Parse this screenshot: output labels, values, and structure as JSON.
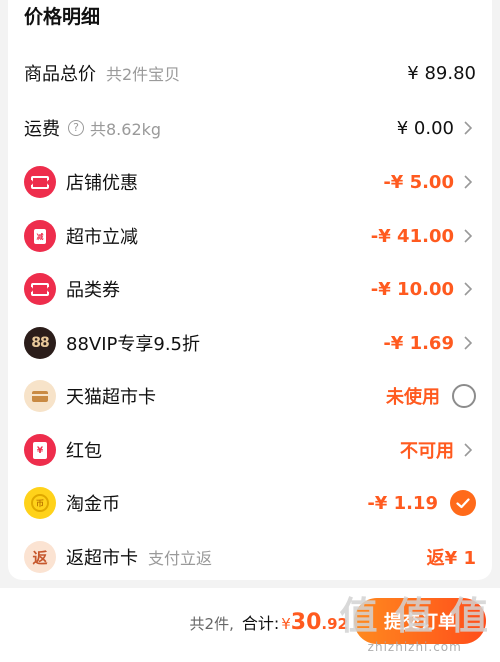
{
  "header": {
    "title": "价格明细"
  },
  "rows": [
    {
      "label": "商品总价",
      "sub": "共2件宝贝",
      "amount": "¥ 89.80"
    },
    {
      "label": "运费",
      "sub": "共8.62kg",
      "amount": "¥ 0.00"
    },
    {
      "label": "店铺优惠",
      "amount": "-¥ 5.00"
    },
    {
      "label": "超市立减",
      "amount": "-¥ 41.00"
    },
    {
      "label": "品类券",
      "amount": "-¥ 10.00"
    },
    {
      "label": "88VIP专享9.5折",
      "icon_text": "88",
      "amount": "-¥ 1.69"
    },
    {
      "label": "天猫超市卡",
      "status": "未使用"
    },
    {
      "label": "红包",
      "status": "不可用"
    },
    {
      "label": "淘金币",
      "amount": "-¥ 1.19"
    },
    {
      "label": "返超市卡",
      "sub": "支付立返",
      "icon_text": "返",
      "status": "返¥ 1"
    }
  ],
  "footer": {
    "count_text": "共2件,",
    "total_label": "合计:",
    "currency": "¥",
    "total_integer": "30",
    "total_decimal": ".92",
    "submit_label": "提交订单"
  },
  "watermark": {
    "big": "值 值 值",
    "small": "zhizhizhi.com"
  },
  "colors": {
    "accent": "#ff5a1f",
    "red": "#ee2d4c"
  }
}
